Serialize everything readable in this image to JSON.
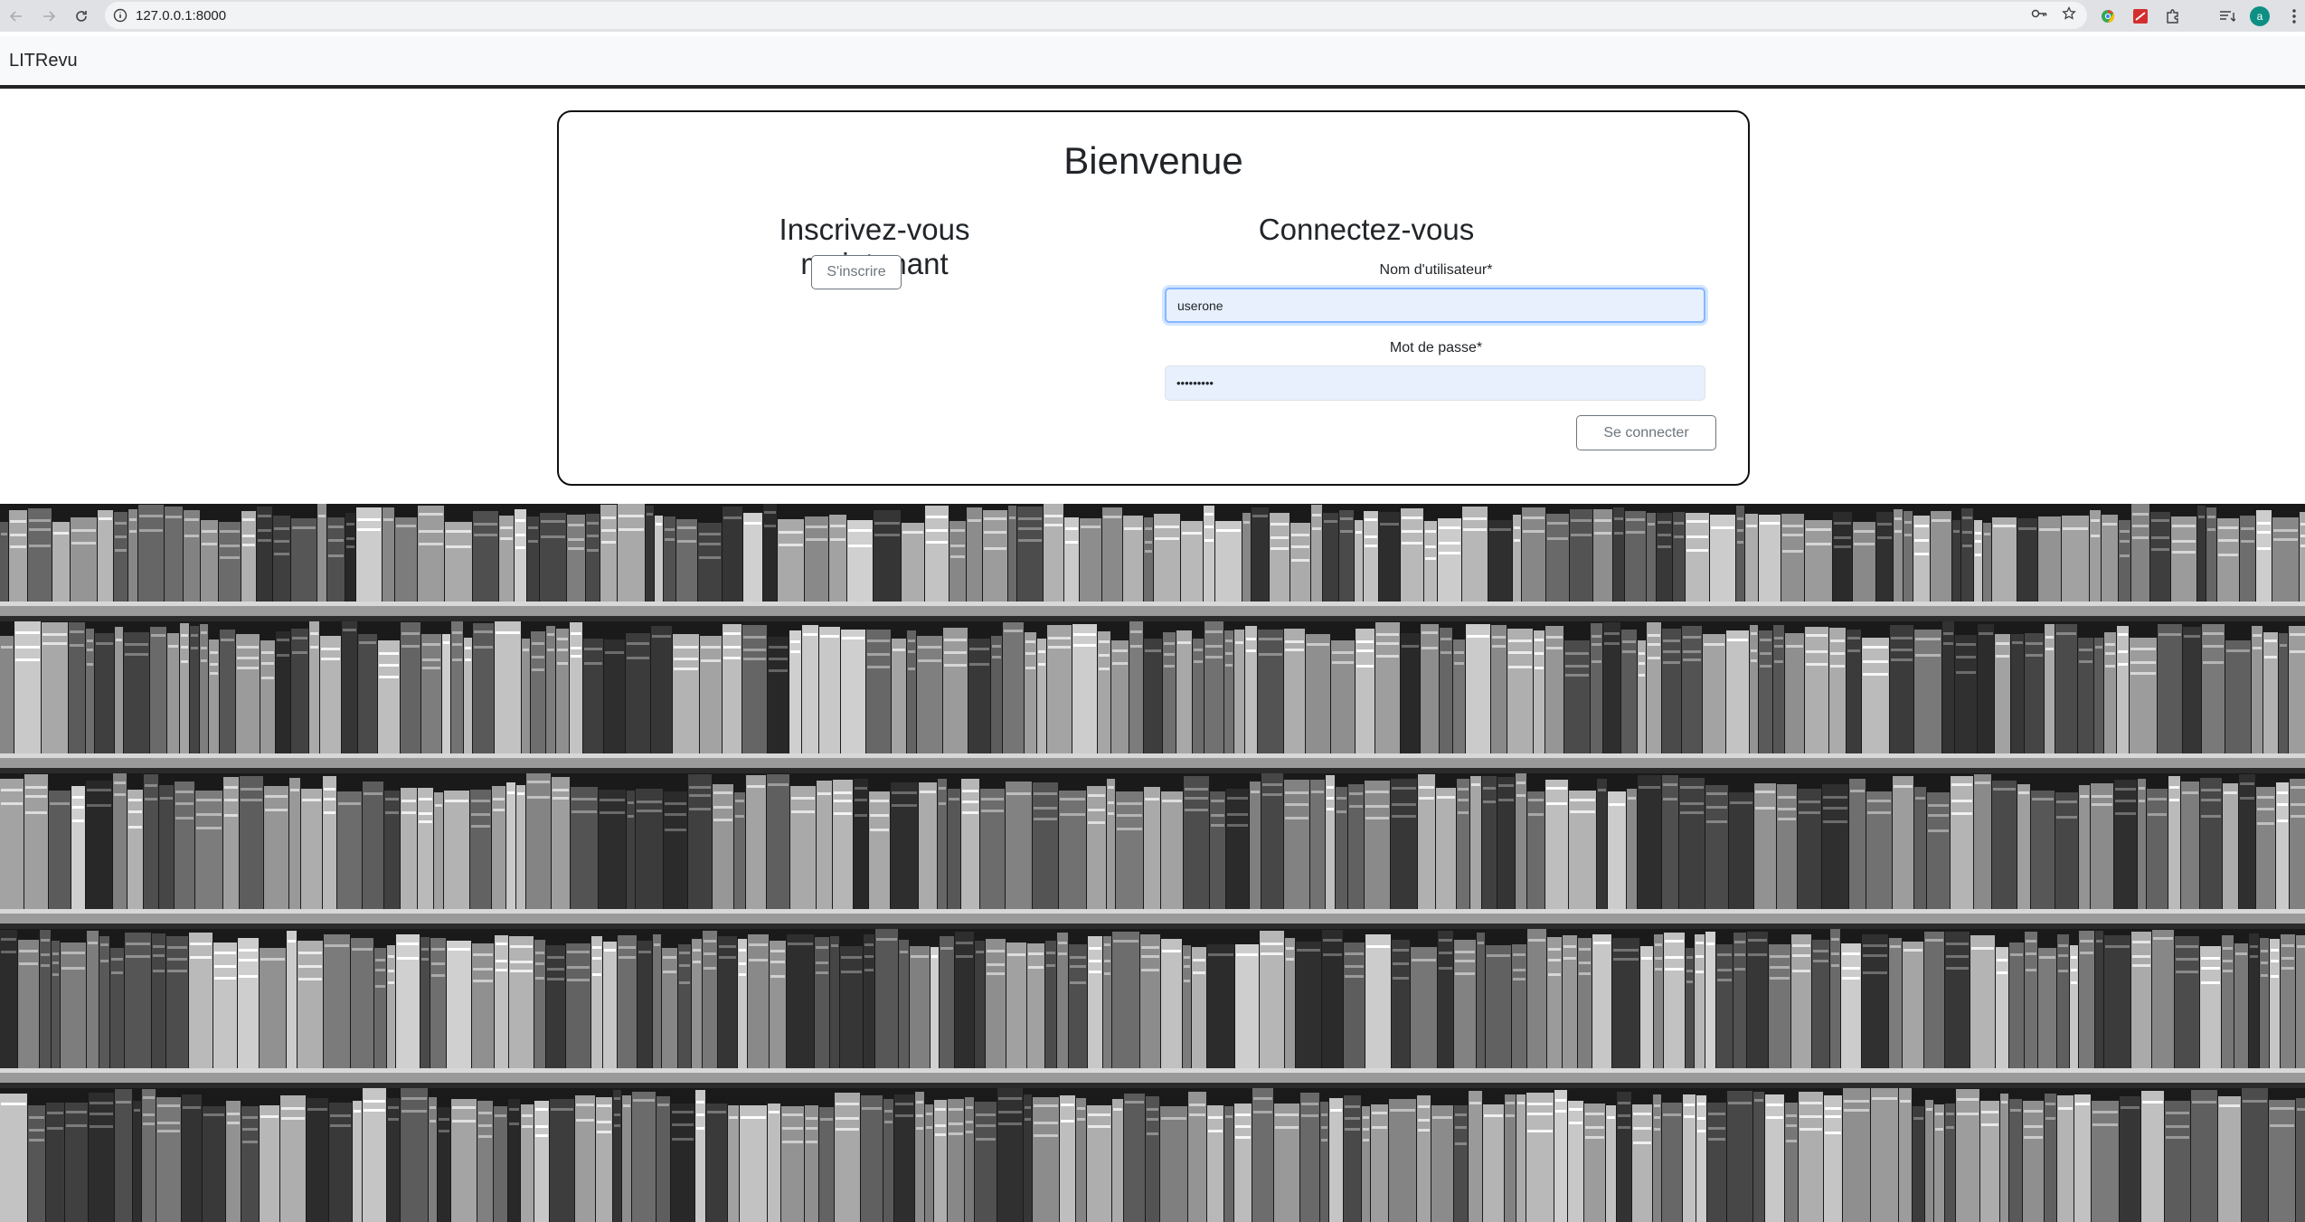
{
  "browser": {
    "url": "127.0.0.1:8000",
    "avatar_letter": "a"
  },
  "navbar": {
    "brand": "LITRevu"
  },
  "card": {
    "title": "Bienvenue",
    "signup": {
      "heading": "Inscrivez-vous maintenant",
      "button_label": "S'inscrire"
    },
    "login": {
      "heading": "Connectez-vous",
      "username_label": "Nom d'utilisateur*",
      "username_value": "userone",
      "password_label": "Mot de passe*",
      "password_value": "•••••••••",
      "submit_label": "Se connecter"
    }
  },
  "colors": {
    "nav_bg": "#f8f9fa",
    "input_autofill": "#e8f0fe",
    "focus_ring": "#86b7fe",
    "secondary": "#6c757d"
  }
}
